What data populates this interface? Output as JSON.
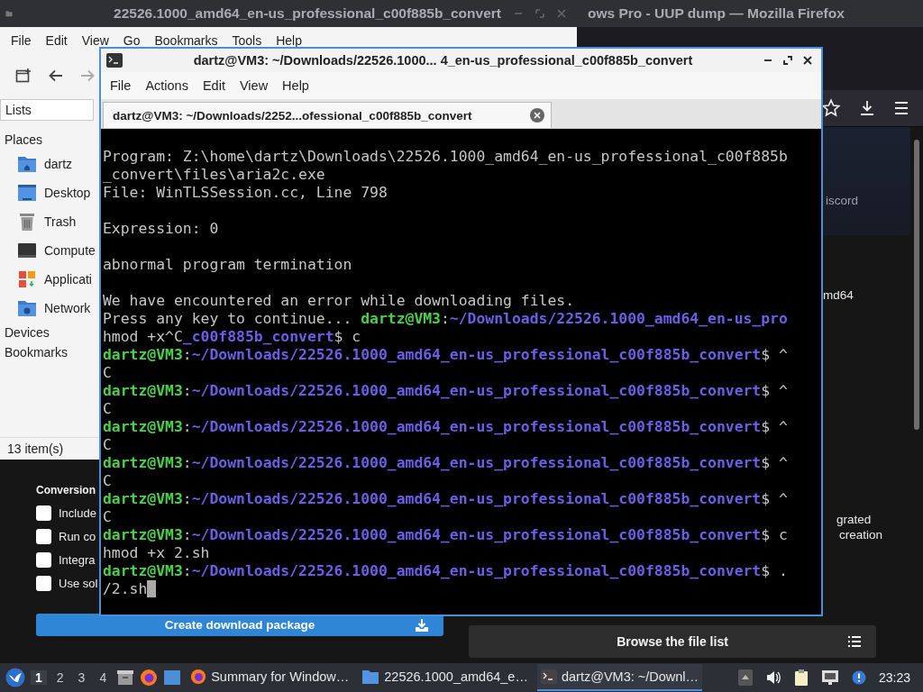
{
  "browser": {
    "title": "ows Pro - UUP dump — Mozilla Firefox",
    "fragments": [
      "iscord",
      "md64",
      "grated",
      "creation"
    ],
    "section_label": "Conversion",
    "options": [
      {
        "label": "Include",
        "checked": false
      },
      {
        "label": "Run co",
        "checked": false
      },
      {
        "label": "Integra",
        "checked": false
      },
      {
        "label": "Use sol",
        "checked": false
      }
    ],
    "create_button": "Create download package",
    "browse_button": "Browse the file list"
  },
  "file_manager": {
    "title": "22526.1000_amd64_en-us_professional_c00f885b_convert",
    "menu": [
      "File",
      "Edit",
      "View",
      "Go",
      "Bookmarks",
      "Tools",
      "Help"
    ],
    "view_select": "Lists",
    "sections": [
      {
        "label": "Places",
        "items": [
          {
            "kind": "home",
            "label": "dartz"
          },
          {
            "kind": "desktop",
            "label": "Desktop"
          },
          {
            "kind": "trash",
            "label": "Trash"
          },
          {
            "kind": "computer",
            "label": "Compute"
          },
          {
            "kind": "apps",
            "label": "Applicati"
          },
          {
            "kind": "network",
            "label": "Network"
          }
        ]
      },
      {
        "label": "Devices"
      },
      {
        "label": "Bookmarks"
      }
    ],
    "status": "13 item(s)"
  },
  "terminal": {
    "title": "dartz@VM3: ~/Downloads/22526.1000... 4_en-us_professional_c00f885b_convert",
    "menu": [
      "File",
      "Actions",
      "Edit",
      "View",
      "Help"
    ],
    "tab": "dartz@VM3: ~/Downloads/2252...ofessional_c00f885b_convert",
    "lines": [
      {
        "segments": [
          {
            "kind": "plain",
            "text": "Program: Z:\\home\\dartz\\Downloads\\22526.1000_amd64_en-us_professional_c00f885b"
          }
        ]
      },
      {
        "segments": [
          {
            "kind": "plain",
            "text": "_convert\\files\\aria2c.exe"
          }
        ]
      },
      {
        "segments": [
          {
            "kind": "plain",
            "text": "File: WinTLSSession.cc, Line 798"
          }
        ]
      },
      {
        "segments": [
          {
            "kind": "plain",
            "text": "Expression: 0"
          }
        ],
        "space_before": true
      },
      {
        "segments": [
          {
            "kind": "plain",
            "text": "abnormal program termination"
          }
        ],
        "space_before": true
      },
      {
        "segments": [
          {
            "kind": "plain",
            "text": "We have encountered an error while downloading files."
          }
        ],
        "space_before": true
      },
      {
        "segments": [
          {
            "kind": "plain",
            "text": "Press any key to continue... "
          },
          {
            "kind": "user",
            "text": "dartz@VM3"
          },
          {
            "kind": "plain",
            "text": ":"
          },
          {
            "kind": "path",
            "text": "~/Downloads/22526.1000_amd64_en-us_pro"
          }
        ]
      },
      {
        "segments": [
          {
            "kind": "plain",
            "text": "hmod +x^C"
          },
          {
            "kind": "path",
            "text": "_c00f885b_convert"
          },
          {
            "kind": "plain",
            "text": "$ c"
          }
        ]
      },
      {
        "segments": [
          {
            "kind": "user",
            "text": "dartz@VM3"
          },
          {
            "kind": "plain",
            "text": ":"
          },
          {
            "kind": "path",
            "text": "~/Downloads/22526.1000_amd64_en-us_professional_c00f885b_convert"
          },
          {
            "kind": "plain",
            "text": "$ ^"
          }
        ]
      },
      {
        "segments": [
          {
            "kind": "plain",
            "text": "C"
          }
        ]
      },
      {
        "segments": [
          {
            "kind": "user",
            "text": "dartz@VM3"
          },
          {
            "kind": "plain",
            "text": ":"
          },
          {
            "kind": "path",
            "text": "~/Downloads/22526.1000_amd64_en-us_professional_c00f885b_convert"
          },
          {
            "kind": "plain",
            "text": "$ ^"
          }
        ]
      },
      {
        "segments": [
          {
            "kind": "plain",
            "text": "C"
          }
        ]
      },
      {
        "segments": [
          {
            "kind": "user",
            "text": "dartz@VM3"
          },
          {
            "kind": "plain",
            "text": ":"
          },
          {
            "kind": "path",
            "text": "~/Downloads/22526.1000_amd64_en-us_professional_c00f885b_convert"
          },
          {
            "kind": "plain",
            "text": "$ ^"
          }
        ]
      },
      {
        "segments": [
          {
            "kind": "plain",
            "text": "C"
          }
        ]
      },
      {
        "segments": [
          {
            "kind": "user",
            "text": "dartz@VM3"
          },
          {
            "kind": "plain",
            "text": ":"
          },
          {
            "kind": "path",
            "text": "~/Downloads/22526.1000_amd64_en-us_professional_c00f885b_convert"
          },
          {
            "kind": "plain",
            "text": "$ ^"
          }
        ]
      },
      {
        "segments": [
          {
            "kind": "plain",
            "text": "C"
          }
        ]
      },
      {
        "segments": [
          {
            "kind": "user",
            "text": "dartz@VM3"
          },
          {
            "kind": "plain",
            "text": ":"
          },
          {
            "kind": "path",
            "text": "~/Downloads/22526.1000_amd64_en-us_professional_c00f885b_convert"
          },
          {
            "kind": "plain",
            "text": "$ ^"
          }
        ]
      },
      {
        "segments": [
          {
            "kind": "plain",
            "text": "C"
          }
        ]
      },
      {
        "segments": [
          {
            "kind": "user",
            "text": "dartz@VM3"
          },
          {
            "kind": "plain",
            "text": ":"
          },
          {
            "kind": "path",
            "text": "~/Downloads/22526.1000_amd64_en-us_professional_c00f885b_convert"
          },
          {
            "kind": "plain",
            "text": "$ c"
          }
        ]
      },
      {
        "segments": [
          {
            "kind": "plain",
            "text": "hmod +x 2.sh"
          }
        ]
      },
      {
        "segments": [
          {
            "kind": "user",
            "text": "dartz@VM3"
          },
          {
            "kind": "plain",
            "text": ":"
          },
          {
            "kind": "path",
            "text": "~/Downloads/22526.1000_amd64_en-us_professional_c00f885b_convert"
          },
          {
            "kind": "plain",
            "text": "$ ."
          }
        ]
      },
      {
        "segments": [
          {
            "kind": "plain",
            "text": "/2.sh"
          }
        ],
        "cursor": true
      }
    ]
  },
  "taskbar": {
    "workspaces": [
      {
        "label": "1",
        "selected": true
      },
      {
        "label": "2",
        "selected": false
      },
      {
        "label": "3",
        "selected": false
      },
      {
        "label": "4",
        "selected": false
      }
    ],
    "tasks": [
      {
        "kind": "browser",
        "label": "Summary for Window…",
        "selected": false
      },
      {
        "kind": "folder",
        "label": "22526.1000_amd64_e…",
        "selected": false
      },
      {
        "kind": "terminal",
        "label": "dartz@VM3: ~/Downl…",
        "selected": true
      }
    ],
    "clock": "23:23"
  }
}
